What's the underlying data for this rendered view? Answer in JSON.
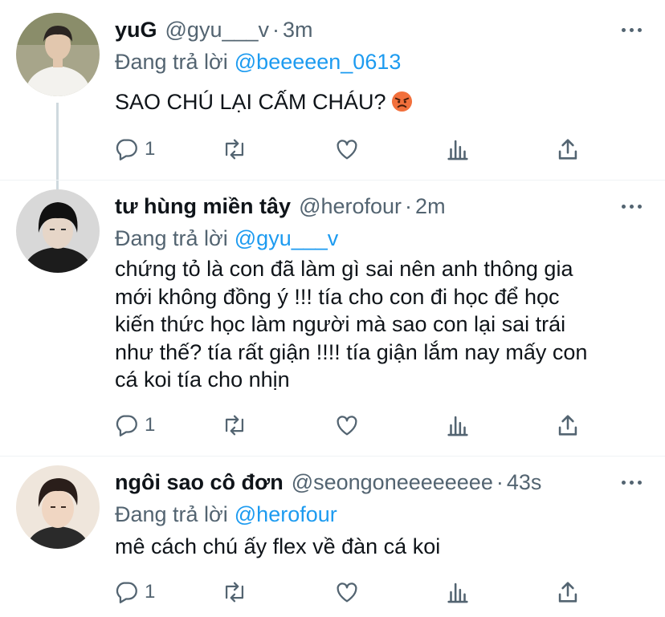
{
  "tweets": [
    {
      "name": "yuG",
      "handle": "@gyu___v",
      "time": "3m",
      "replying_label": "Đang trả lời",
      "replying_to": "@beeeeen_0613",
      "text": "SAO CHÚ LẠI CẤM CHÁU?",
      "emoji": "angry-face",
      "reply_count": "1"
    },
    {
      "name": "tư hùng miền tây",
      "handle": "@herofour",
      "time": "2m",
      "replying_label": "Đang trả lời",
      "replying_to": "@gyu___v",
      "text_lines": [
        "chứng tỏ là con đã làm gì sai nên anh thông gia",
        "mới không đồng ý !!! tía cho con đi học để học",
        "kiến thức học làm người mà sao con lại sai trái",
        "như thế? tía rất giận !!!! tía giận lắm nay mấy con",
        "cá koi tía cho nhịn"
      ],
      "reply_count": "1"
    },
    {
      "name": "ngôi sao cô đơn",
      "handle": "@seongoneeeeeeee",
      "time": "43s",
      "replying_label": "Đang trả lời",
      "replying_to": "@herofour",
      "text": "mê cách chú ấy flex về đàn cá koi",
      "reply_count": "1"
    }
  ],
  "icons": [
    "reply-icon",
    "retweet-icon",
    "like-icon",
    "analytics-icon",
    "share-icon",
    "more-icon"
  ],
  "colors": {
    "link": "#1d9bf0",
    "muted": "#536471",
    "text": "#0f1419",
    "thread_line": "#cfd9de"
  }
}
